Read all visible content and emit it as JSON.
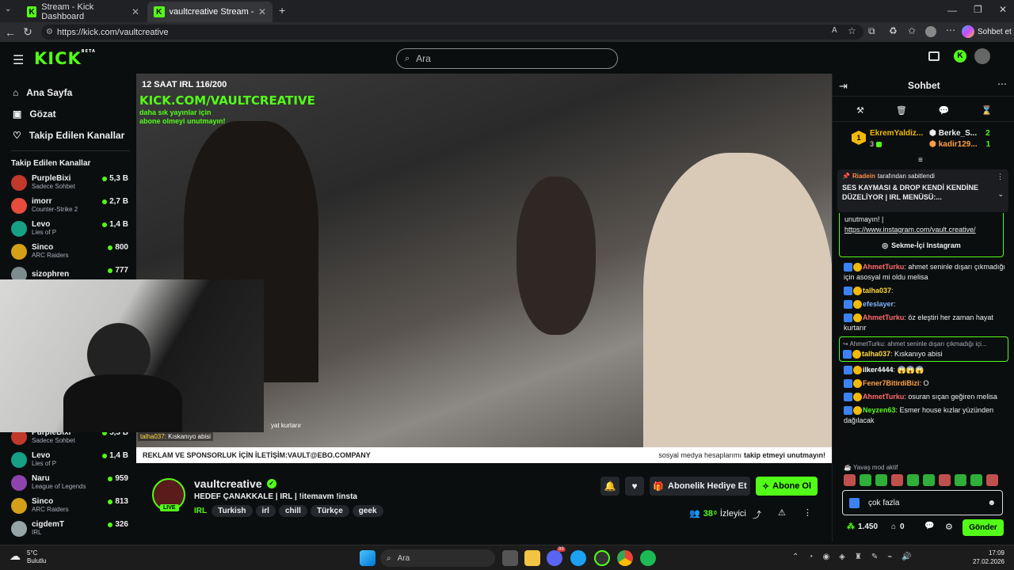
{
  "browser": {
    "tabs": [
      {
        "label": "Stream - Kick Dashboard"
      },
      {
        "label": "vaultcreative Stream - Watch"
      }
    ],
    "url": "https://kick.com/vaultcreative",
    "profile_btn": "Sohbet et"
  },
  "header": {
    "logo": "KICK",
    "beta": "BETA",
    "search_placeholder": "Ara"
  },
  "sidebar": {
    "nav": [
      {
        "label": "Ana Sayfa",
        "icon": "home-icon"
      },
      {
        "label": "Gözat",
        "icon": "browse-icon"
      },
      {
        "label": "Takip Edilen Kanallar",
        "icon": "heart-icon"
      }
    ],
    "section_title": "Takip Edilen Kanallar",
    "channels": [
      {
        "name": "PurpleBixi",
        "sub": "Sadece Sohbet",
        "viewers": "5,3 B",
        "color": "#c0392b"
      },
      {
        "name": "imorr",
        "sub": "Counter-Strike 2",
        "viewers": "2,7 B",
        "color": "#e74c3c"
      },
      {
        "name": "Levo",
        "sub": "Lies of P",
        "viewers": "1,4 B",
        "color": "#16a085"
      },
      {
        "name": "Sinco",
        "sub": "ARC Raiders",
        "viewers": "800",
        "color": "#d4a017"
      },
      {
        "name": "sizophren",
        "sub": "",
        "viewers": "777",
        "color": "#7f8c8d"
      }
    ],
    "channels_lower": [
      {
        "name": "PurpleBixi",
        "sub": "Sadece Sohbet",
        "viewers": "5,3 B",
        "color": "#c0392b"
      },
      {
        "name": "Levo",
        "sub": "Lies of P",
        "viewers": "1,4 B",
        "color": "#16a085"
      },
      {
        "name": "Naru",
        "sub": "League of Legends",
        "viewers": "959",
        "color": "#8e44ad"
      },
      {
        "name": "Sinco",
        "sub": "ARC Raiders",
        "viewers": "813",
        "color": "#d4a017"
      },
      {
        "name": "cigdemT",
        "sub": "IRL",
        "viewers": "326",
        "color": "#95a5a6"
      }
    ]
  },
  "video": {
    "title_overlay": "12 SAAT IRL 116/200",
    "brand_overlay": "KICK.COM/VAULTCREATIVE",
    "sub_overlay_1": "daha sık          yayınlar için",
    "sub_overlay_2": "abone olmeyi unutmayın!",
    "chat_overlay_user": "talha037",
    "chat_overlay_msg": ": Kıskanıyo abisi",
    "chat_overlay_2": "yat kurtarır",
    "ad_left_1": "REKLAM VE SPONSORLUK İÇİN İLETİŞİM: ",
    "ad_left_2": "VAULT@EBO.COMPANY",
    "ad_right_1": "sosyal medya hesaplarımı ",
    "ad_right_2": "takip etmeyi unutmayın!"
  },
  "stream": {
    "name": "vaultcreative",
    "live": "LIVE",
    "title": "HEDEF ÇANAKKALE | IRL | !itemavm !insta",
    "category": "IRL",
    "tags": [
      "Turkish",
      "irl",
      "chill",
      "Türkçe",
      "geek"
    ],
    "viewers": "38",
    "viewers_sup": "0",
    "viewers_label": "İzleyici",
    "gift_btn": "Abonelik Hediye Et",
    "sub_btn": "Abone Ol"
  },
  "chat": {
    "title": "Sohbet",
    "leaders": [
      {
        "rank": "1",
        "name": "EkremYaldiz...",
        "count": "3"
      },
      {
        "name": "Berke_S...",
        "count": "2"
      },
      {
        "name": "kadir129...",
        "count": "1"
      }
    ],
    "pinned_by": "Riadein",
    "pinned_suffix": "tarafından sabitlendi",
    "pinned_text": "SES KAYMASI & DROP KENDİ KENDİNE DÜZELİYOR | IRL MENÜSÜ:...",
    "pinned_tail": "unutmayın! |",
    "pinned_link": "https://www.instagram.com/vault.creative/",
    "insta_btn": "Sekme-İçi Instagram",
    "messages": [
      {
        "user": "AhmetTurku",
        "color": "#ff6b6b",
        "text": ": ahmet seninle dışarı çıkmadığı için asosyal mi oldu melisa"
      },
      {
        "user": "talha037",
        "color": "#ffd93d",
        "text": ":"
      },
      {
        "user": "efeslayer",
        "color": "#7fb3ff",
        "text": ":"
      },
      {
        "user": "AhmetTurku",
        "color": "#ff6b6b",
        "text": ": öz eleştiri her zaman hayat kurtarır"
      },
      {
        "reply": "↪ AhmetTurku: ahmet seninle dışarı çıkmadığı içi...",
        "user": "talha037",
        "color": "#ffd93d",
        "text": ": Kıskanıyo abisi"
      },
      {
        "user": "ilker4444",
        "color": "#ffffff",
        "text": ": 😱😱😱"
      },
      {
        "user": "Fener7BitirdiBizi",
        "color": "#ff9f43",
        "text": ": O"
      },
      {
        "user": "AhmetTurku",
        "color": "#ff6b6b",
        "text": ": osuran sıçan geğiren melisa"
      },
      {
        "user": "Neyzen63",
        "color": "#53fc18",
        "text": ": Esmer house kızlar yüzünden dağılacak"
      }
    ],
    "slow_mode": "Yavaş mod aktif",
    "input_value": "çok fazla",
    "points": "1.450",
    "count": "0",
    "send": "Gönder"
  },
  "taskbar": {
    "weather_temp": "5°C",
    "weather_desc": "Bulutlu",
    "search": "Ara",
    "time": "17:09",
    "date": "27.02.2026",
    "notif": "99"
  }
}
